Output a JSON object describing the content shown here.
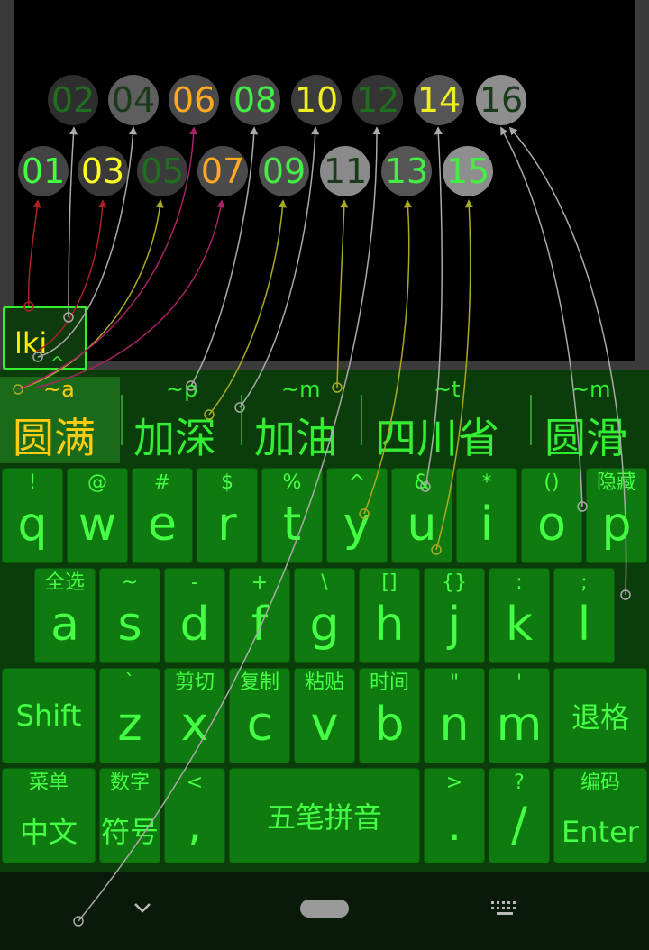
{
  "colors": {
    "accent": "#33ee33",
    "highlight": "#ffcc11",
    "keyBg": "#0f7a0f",
    "boardBg": "#0a3d0a"
  },
  "circles": [
    {
      "label": "02",
      "bg": "#2e2e2e",
      "fg": "#1f6f1f"
    },
    {
      "label": "04",
      "bg": "#5e5e5e",
      "fg": "#1a3a1a"
    },
    {
      "label": "06",
      "bg": "#4a4a4a",
      "fg": "#ffaa22"
    },
    {
      "label": "08",
      "bg": "#474747",
      "fg": "#44ee44"
    },
    {
      "label": "10",
      "bg": "#3c3c3c",
      "fg": "#eeee22"
    },
    {
      "label": "12",
      "bg": "#343434",
      "fg": "#1f6f1f"
    },
    {
      "label": "14",
      "bg": "#555555",
      "fg": "#eeee22"
    },
    {
      "label": "16",
      "bg": "#8e8e8e",
      "fg": "#1a3a1a"
    },
    {
      "label": "01",
      "bg": "#444444",
      "fg": "#44ff44"
    },
    {
      "label": "03",
      "bg": "#3a3a3a",
      "fg": "#ffff22"
    },
    {
      "label": "05",
      "bg": "#3a3a3a",
      "fg": "#1f6f1f"
    },
    {
      "label": "07",
      "bg": "#4a4a4a",
      "fg": "#ffaa22"
    },
    {
      "label": "09",
      "bg": "#4e4e4e",
      "fg": "#44ee44"
    },
    {
      "label": "11",
      "bg": "#8a8a8a",
      "fg": "#1a3a1a"
    },
    {
      "label": "13",
      "bg": "#555555",
      "fg": "#44ee44"
    },
    {
      "label": "15",
      "bg": "#8e8e8e",
      "fg": "#44ee44"
    }
  ],
  "input": {
    "text": "lki",
    "caret": "^"
  },
  "candidates": [
    {
      "hint": "~a",
      "text": "圆满"
    },
    {
      "hint": "~p",
      "text": "加深"
    },
    {
      "hint": "~m",
      "text": "加油"
    },
    {
      "hint": "~t",
      "text": "四川省"
    },
    {
      "hint": "~m",
      "text": "圆滑"
    }
  ],
  "rows": {
    "r1": [
      {
        "sec": "!",
        "pri": "q"
      },
      {
        "sec": "@",
        "pri": "w"
      },
      {
        "sec": "#",
        "pri": "e"
      },
      {
        "sec": "$",
        "pri": "r"
      },
      {
        "sec": "%",
        "pri": "t"
      },
      {
        "sec": "^",
        "pri": "y"
      },
      {
        "sec": "&",
        "pri": "u"
      },
      {
        "sec": "*",
        "pri": "i"
      },
      {
        "sec": "()",
        "pri": "o"
      },
      {
        "sec": "隐藏",
        "pri": "p"
      }
    ],
    "r2": [
      {
        "sec": "全选",
        "pri": "a"
      },
      {
        "sec": "~",
        "pri": "s"
      },
      {
        "sec": "-",
        "pri": "d"
      },
      {
        "sec": "+",
        "pri": "f"
      },
      {
        "sec": "\\",
        "pri": "g"
      },
      {
        "sec": "[]",
        "pri": "h"
      },
      {
        "sec": "{}",
        "pri": "j"
      },
      {
        "sec": ":",
        "pri": "k"
      },
      {
        "sec": ";",
        "pri": "l"
      }
    ],
    "r3": [
      {
        "sec": "`",
        "pri": "z"
      },
      {
        "sec": "剪切",
        "pri": "x"
      },
      {
        "sec": "复制",
        "pri": "c"
      },
      {
        "sec": "粘贴",
        "pri": "v"
      },
      {
        "sec": "时间",
        "pri": "b"
      },
      {
        "sec": "\"",
        "pri": "n"
      },
      {
        "sec": "'",
        "pri": "m"
      }
    ],
    "shift": "Shift",
    "backspace": "退格"
  },
  "bottom": {
    "menu": {
      "sec": "菜单",
      "label": "中文"
    },
    "num": {
      "sec": "数字",
      "label": "符号"
    },
    "comma": {
      "sec": "<",
      "label": ","
    },
    "space": "五笔拼音",
    "period": {
      "sec": ">",
      "label": "."
    },
    "slash": {
      "sec": "?",
      "label": "/"
    },
    "enter": {
      "sec": "编码",
      "label": "Enter"
    }
  },
  "nav": {
    "back_icon": "chevron-down-icon",
    "home_icon": "home-pill-icon",
    "ime_icon": "keyboard-icon"
  }
}
